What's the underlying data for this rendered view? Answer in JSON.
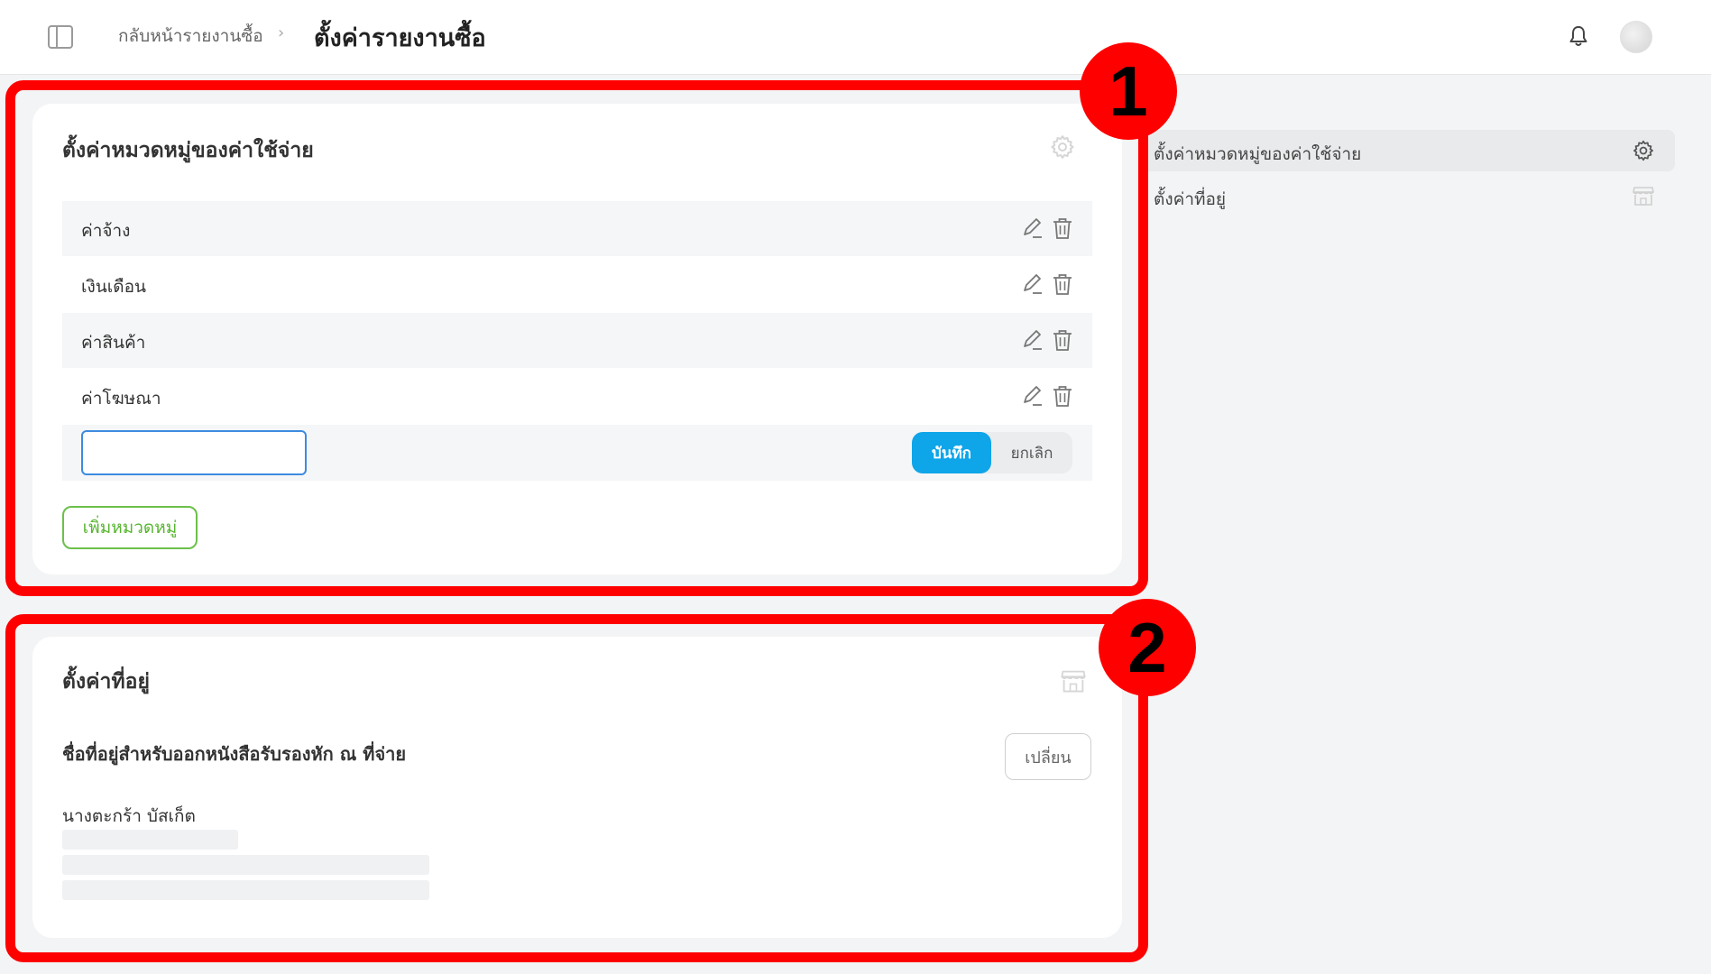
{
  "header": {
    "breadcrumb_back": "กลับหน้ารายงานซื้อ",
    "breadcrumb_separator": "›",
    "title": "ตั้งค่ารายงานซื้อ"
  },
  "expense_categories": {
    "title": "ตั้งค่าหมวดหมู่ของค่าใช้จ่าย",
    "items": [
      {
        "label": "ค่าจ้าง"
      },
      {
        "label": "เงินเดือน"
      },
      {
        "label": "ค่าสินค้า"
      },
      {
        "label": "ค่าโฆษณา"
      }
    ],
    "new_item_input": {
      "value": "",
      "placeholder": ""
    },
    "save_label": "บันทึก",
    "cancel_label": "ยกเลิก",
    "add_label": "เพิ่มหมวดหมู่"
  },
  "address": {
    "title": "ตั้งค่าที่อยู่",
    "subtitle": "ชื่อที่อยู่สำหรับออกหนังสือรับรองหัก ณ ที่จ่าย",
    "change_label": "เปลี่ยน",
    "name": "นางตะกร้า บัสเก็ต"
  },
  "right_nav": {
    "items": [
      {
        "label": "ตั้งค่าหมวดหมู่ของค่าใช้จ่าย",
        "icon": "gear-icon"
      },
      {
        "label": "ตั้งค่าที่อยู่",
        "icon": "store-icon"
      }
    ]
  },
  "annotations": {
    "badge1": "1",
    "badge2": "2"
  },
  "colors": {
    "accent": "#0ea5e9",
    "add_button": "#58b530",
    "annotation": "#ff0000",
    "input_border": "#3d8be0"
  }
}
